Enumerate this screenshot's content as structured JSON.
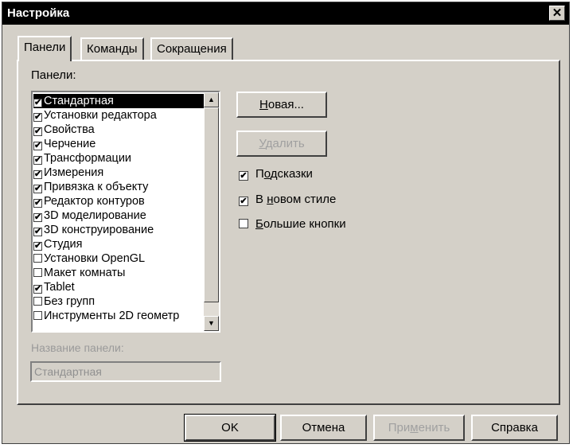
{
  "window": {
    "title": "Настройка",
    "close_glyph": "✕"
  },
  "tabs": [
    {
      "label": "Панели",
      "active": true
    },
    {
      "label": "Команды",
      "active": false
    },
    {
      "label": "Сокращения",
      "active": false
    }
  ],
  "panels_label": "Панели:",
  "panels_list": [
    {
      "label": "Стандартная",
      "checked": true,
      "selected": true
    },
    {
      "label": "Установки редактора",
      "checked": true
    },
    {
      "label": "Свойства",
      "checked": true
    },
    {
      "label": "Черчение",
      "checked": true
    },
    {
      "label": "Трансформации",
      "checked": true
    },
    {
      "label": "Измерения",
      "checked": true
    },
    {
      "label": "Привязка к объекту",
      "checked": true
    },
    {
      "label": "Редактор контуров",
      "checked": true
    },
    {
      "label": "3D моделирование",
      "checked": true
    },
    {
      "label": "3D конструирование",
      "checked": true
    },
    {
      "label": "Студия",
      "checked": true
    },
    {
      "label": "Установки OpenGL",
      "checked": false
    },
    {
      "label": "Макет комнаты",
      "checked": false
    },
    {
      "label": "Tablet",
      "checked": true
    },
    {
      "label": "Без групп",
      "checked": false
    },
    {
      "label": "Инструменты 2D геометр",
      "checked": false
    }
  ],
  "buttons": {
    "new_prefix": "Н",
    "new_rest": "овая...",
    "delete_prefix": "У",
    "delete_rest": "далить",
    "ok": "OK",
    "cancel": "Отмена",
    "apply_a": "При",
    "apply_b": "м",
    "apply_c": "енить",
    "help": "Справка"
  },
  "options": {
    "tooltips_a": "П",
    "tooltips_b": "о",
    "tooltips_c": "дсказки",
    "tooltips_checked": true,
    "newstyle_a": "В ",
    "newstyle_b": "н",
    "newstyle_c": "овом стиле",
    "newstyle_checked": true,
    "bigbuttons_a": "Б",
    "bigbuttons_b": "ольшие кнопки",
    "bigbuttons_checked": false
  },
  "panel_name_label": "Название панели:",
  "panel_name_value": "Стандартная",
  "check_glyph": "✔",
  "icons": {
    "close": "close-icon",
    "scroll_up": "scroll-up-icon",
    "scroll_down": "scroll-down-icon"
  }
}
